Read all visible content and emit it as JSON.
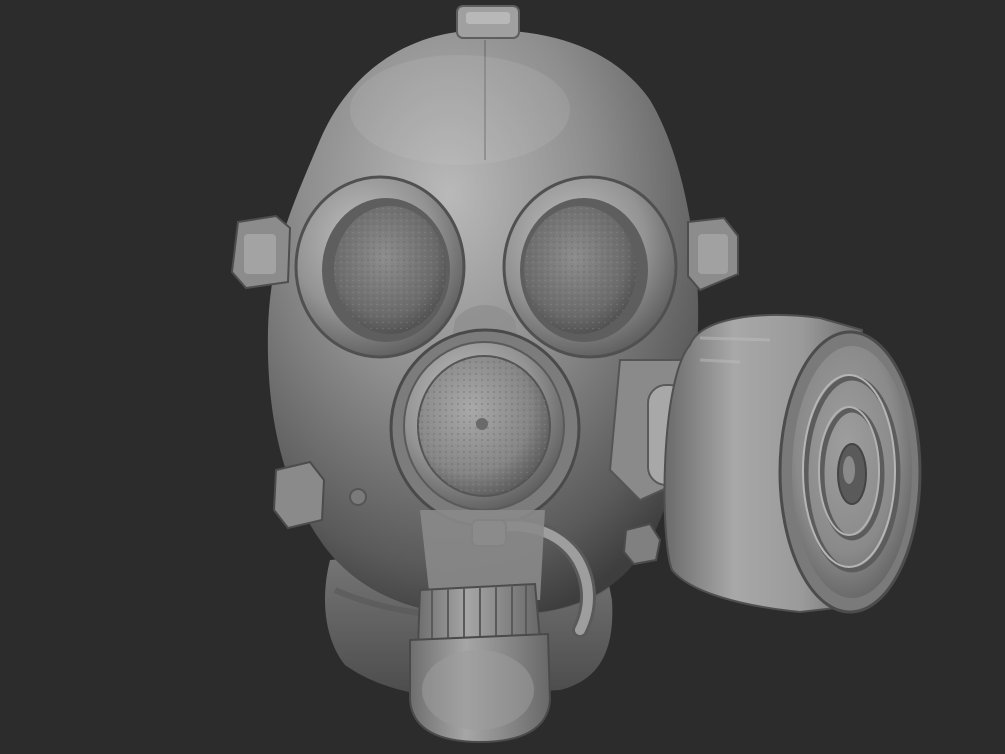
{
  "viewport": {
    "background": "#2c2c2c",
    "subject": "gas-mask-sculpt",
    "material_base": "#8a8a8a",
    "material_highlight": "#c4c4c4",
    "material_shadow": "#3a3a3a"
  }
}
